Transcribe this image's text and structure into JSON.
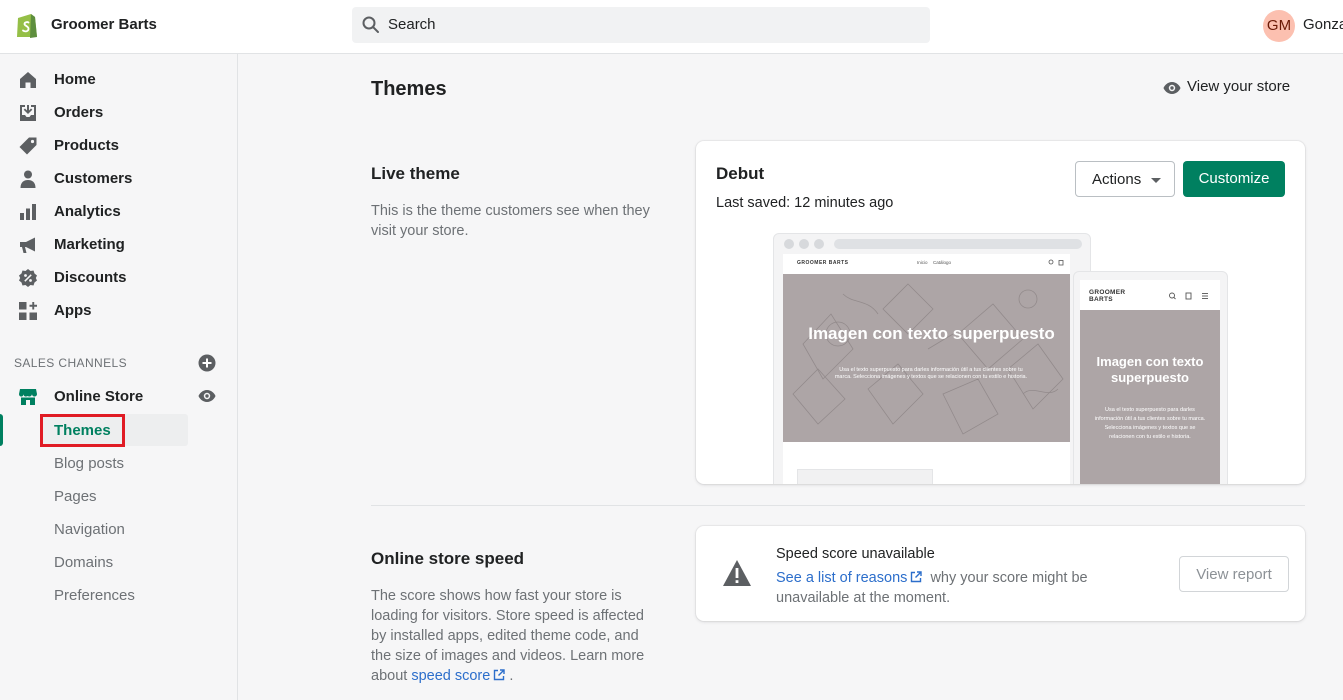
{
  "header": {
    "store_name": "Groomer Barts",
    "search_placeholder": "Search",
    "user_initials": "GM",
    "user_name": "Gonza"
  },
  "sidebar": {
    "items": [
      {
        "label": "Home",
        "icon": "home-icon"
      },
      {
        "label": "Orders",
        "icon": "orders-icon"
      },
      {
        "label": "Products",
        "icon": "tag-icon"
      },
      {
        "label": "Customers",
        "icon": "person-icon"
      },
      {
        "label": "Analytics",
        "icon": "bar-chart-icon"
      },
      {
        "label": "Marketing",
        "icon": "megaphone-icon"
      },
      {
        "label": "Discounts",
        "icon": "discount-icon"
      },
      {
        "label": "Apps",
        "icon": "apps-icon"
      }
    ],
    "sales_channels_heading": "SALES CHANNELS",
    "online_store_label": "Online Store",
    "subitems": [
      "Themes",
      "Blog posts",
      "Pages",
      "Navigation",
      "Domains",
      "Preferences"
    ],
    "active_subitem": "Themes"
  },
  "main": {
    "page_title": "Themes",
    "view_store_label": "View your store",
    "live_theme": {
      "title": "Live theme",
      "description": "This is the theme customers see when they visit your store."
    },
    "theme_card": {
      "name": "Debut",
      "last_saved": "Last saved: 12 minutes ago",
      "actions_label": "Actions",
      "customize_label": "Customize",
      "preview": {
        "desktop_brand": "GROOMER BARTS",
        "desktop_nav": [
          "Inicio",
          "Catálogo"
        ],
        "hero_title": "Imagen con texto superpuesto",
        "hero_subtitle": "Usa el texto superpuesto para darles información útil a tus clientes sobre tu marca. Selecciona imágenes y textos que se relacionen con tu estilo e historia.",
        "mobile_brand_line1": "GROOMER",
        "mobile_brand_line2": "BARTS",
        "mobile_hero_title": "Imagen con texto superpuesto",
        "mobile_hero_subtitle": "Usa el texto superpuesto para darles información útil a tus clientes sobre tu marca. Selecciona imágenes y textos que se relacionen con tu estilo e historia."
      }
    },
    "speed": {
      "title": "Online store speed",
      "description_prefix": "The score shows how fast your store is loading for visitors. Store speed is affected by installed apps, edited theme code, and the size of images and videos. Learn more about",
      "description_link": "speed score",
      "description_suffix": ".",
      "card_title": "Speed score unavailable",
      "card_link": "See a list of reasons",
      "card_text": "why your score might be unavailable at the moment.",
      "report_label": "View report"
    }
  },
  "colors": {
    "brand_green": "#008060",
    "link_blue": "#2c6ecb",
    "highlight_red": "#e01b24",
    "avatar_bg": "#fcc0b0"
  }
}
